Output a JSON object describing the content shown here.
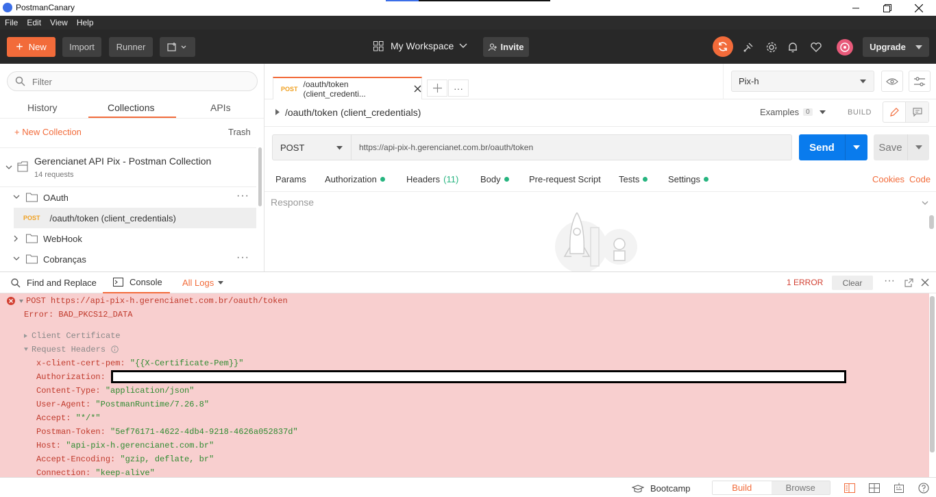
{
  "window": {
    "title": "PostmanCanary",
    "loading_progress": 0.2
  },
  "menu": [
    "File",
    "Edit",
    "View",
    "Help"
  ],
  "header": {
    "new_label": "New",
    "import_label": "Import",
    "runner_label": "Runner",
    "workspace_label": "My Workspace",
    "invite_label": "Invite",
    "upgrade_label": "Upgrade"
  },
  "sidebar": {
    "filter_placeholder": "Filter",
    "tabs": [
      "History",
      "Collections",
      "APIs"
    ],
    "new_collection_label": "+ New Collection",
    "trash_label": "Trash",
    "collection": {
      "name": "Gerencianet API Pix - Postman Collection",
      "count": "14 requests"
    },
    "folders": {
      "oauth": "OAuth",
      "request_method": "POST",
      "request_name": "/oauth/token (client_credentials)",
      "webhook": "WebHook",
      "cobrancas": "Cobranças"
    }
  },
  "request_tab": {
    "method": "POST",
    "title": "/oauth/token (client_credenti..."
  },
  "environment": {
    "selected": "Pix-h"
  },
  "request": {
    "name": "/oauth/token (client_credentials)",
    "examples_label": "Examples",
    "examples_count": "0",
    "build_label": "BUILD",
    "method": "POST",
    "url": "https://api-pix-h.gerencianet.com.br/oauth/token",
    "send_label": "Send",
    "save_label": "Save",
    "nav": {
      "params": "Params",
      "authorization": "Authorization",
      "headers": "Headers",
      "headers_count": "(11)",
      "body": "Body",
      "prerequest": "Pre-request Script",
      "tests": "Tests",
      "settings": "Settings",
      "cookies": "Cookies",
      "code": "Code"
    },
    "response_label": "Response"
  },
  "console": {
    "find_replace_label": "Find and Replace",
    "console_label": "Console",
    "all_logs_label": "All Logs",
    "error_count": "1 ERROR",
    "clear_label": "Clear",
    "entry_method": "POST",
    "entry_url": "https://api-pix-h.gerencianet.com.br/oauth/token",
    "error_text": "Error: BAD_PKCS12_DATA",
    "client_cert": "Client Certificate",
    "request_headers": "Request Headers",
    "headers": [
      {
        "key": "x-client-cert-pem:",
        "value": "\"{{X-Certificate-Pem}}\""
      },
      {
        "key": "Authorization:",
        "value": ""
      },
      {
        "key": "Content-Type:",
        "value": "\"application/json\""
      },
      {
        "key": "User-Agent:",
        "value": "\"PostmanRuntime/7.26.8\""
      },
      {
        "key": "Accept:",
        "value": "\"*/*\""
      },
      {
        "key": "Postman-Token:",
        "value": "\"5ef76171-4622-4db4-9218-4626a052837d\""
      },
      {
        "key": "Host:",
        "value": "\"api-pix-h.gerencianet.com.br\""
      },
      {
        "key": "Accept-Encoding:",
        "value": "\"gzip, deflate, br\""
      },
      {
        "key": "Connection:",
        "value": "\"keep-alive\""
      }
    ]
  },
  "statusbar": {
    "bootcamp_label": "Bootcamp",
    "build_label": "Build",
    "browse_label": "Browse"
  },
  "colors": {
    "accent": "#f26b3a",
    "send": "#097bed",
    "green_dot": "#26b47f",
    "error": "#d23f31",
    "console_bg": "#f8cfcf"
  }
}
